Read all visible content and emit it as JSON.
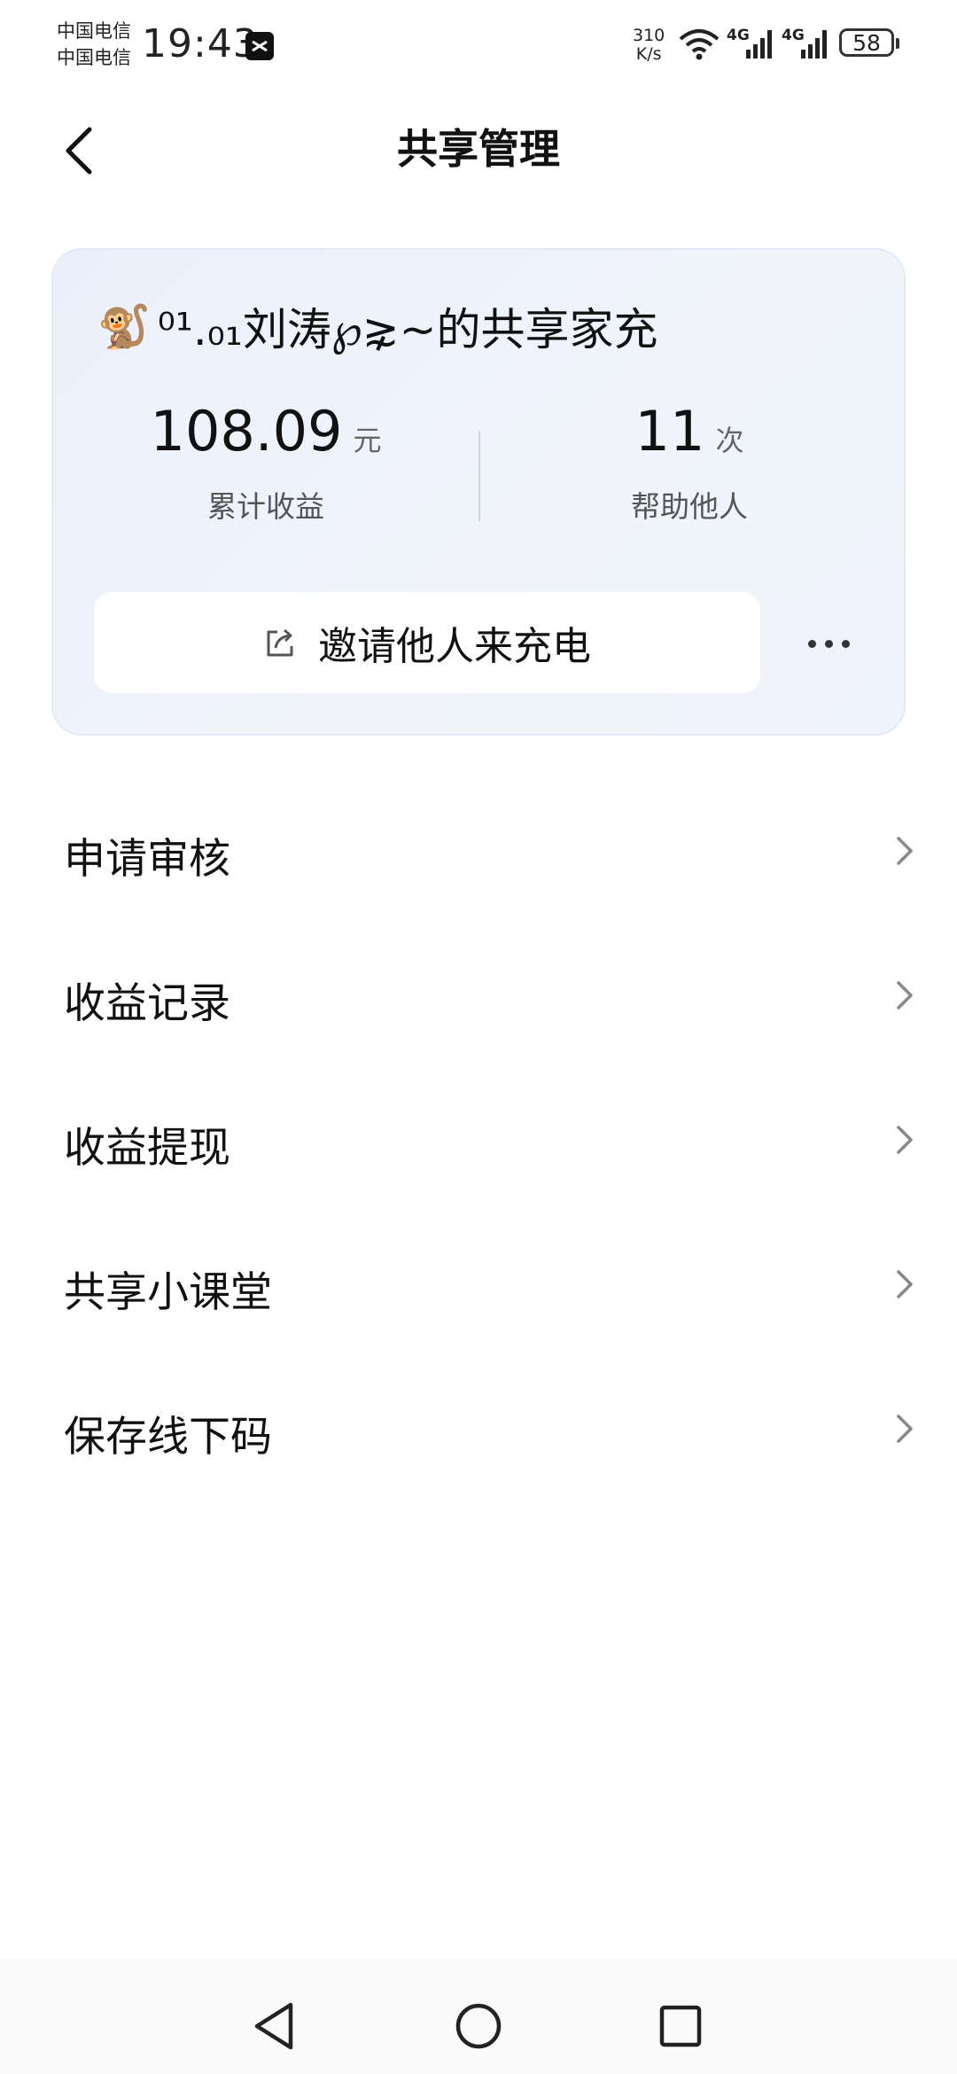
{
  "status_bar": {
    "carrier_1": "中国电信",
    "carrier_2": "中国电信",
    "time": "19:43",
    "net_speed_value": "310",
    "net_speed_unit": "K/s",
    "signal_1_label": "4G",
    "signal_2_label": "4G",
    "battery_level": "58"
  },
  "header": {
    "title": "共享管理",
    "back_icon": "chevron-left-icon"
  },
  "share_card": {
    "avatar_icon": "🐒",
    "title": "⁰¹.₀₁刘涛℘⋧~的共享家充",
    "earnings": {
      "value": "108.09",
      "unit": "元",
      "label": "累计收益"
    },
    "helped": {
      "value": "11",
      "unit": "次",
      "label": "帮助他人"
    },
    "invite_label": "邀请他人来充电",
    "invite_icon": "share-icon",
    "more_icon": "more-dots-icon"
  },
  "menu": {
    "items": [
      {
        "label": "申请审核"
      },
      {
        "label": "收益记录"
      },
      {
        "label": "收益提现"
      },
      {
        "label": "共享小课堂"
      },
      {
        "label": "保存线下码"
      }
    ]
  },
  "nav_bar": {
    "back_icon": "triangle-back-icon",
    "home_icon": "circle-home-icon",
    "recents_icon": "square-recents-icon"
  }
}
